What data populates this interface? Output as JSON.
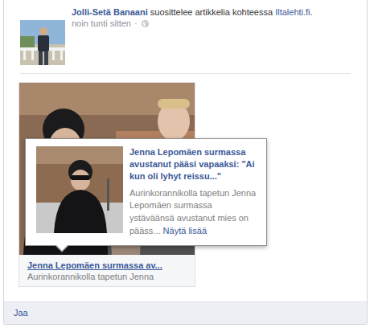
{
  "post": {
    "author": "Jolli-Setä Banaani",
    "action": "suosittelee artikkelia kohteessa",
    "source": "Iltalehti.fi.",
    "time": "noin tunti sitten",
    "separator": "·"
  },
  "attachment": {
    "title": "Jenna Lepomäen surmassa av...",
    "summary": "Aurinkorannikolla tapetun Jenna"
  },
  "hovercard": {
    "title": "Jenna Lepomäen surmassa avustanut pääsi vapaaksi: \"Ai kun oli lyhyt reissu...\"",
    "description": "Aurinkorannikolla tapetun Jenna Lepomäen surmassa ystäväänsä avustanut mies on pääss...",
    "more": "Näytä lisää"
  },
  "actions": [
    "Jaa"
  ]
}
